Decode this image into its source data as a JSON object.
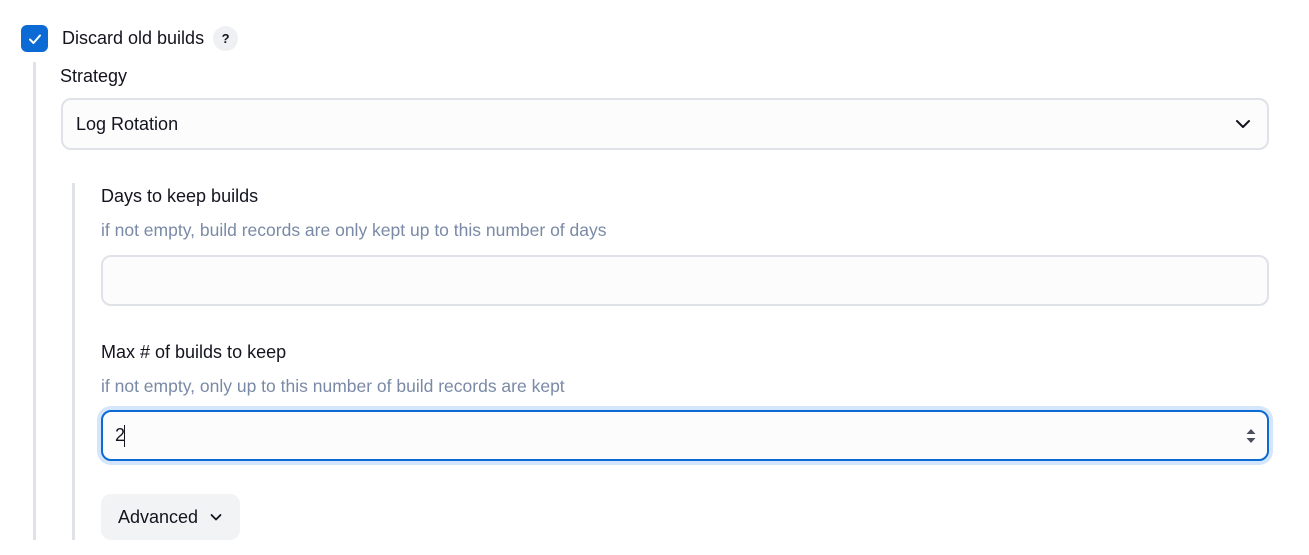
{
  "discard_old_builds": {
    "label": "Discard old builds",
    "checked": true,
    "help_label": "?"
  },
  "strategy": {
    "label": "Strategy",
    "selected": "Log Rotation"
  },
  "days_to_keep": {
    "label": "Days to keep builds",
    "description": "if not empty, build records are only kept up to this number of days",
    "value": ""
  },
  "max_builds": {
    "label": "Max # of builds to keep",
    "description": "if not empty, only up to this number of build records are kept",
    "value": "2"
  },
  "advanced": {
    "label": "Advanced"
  },
  "colors": {
    "accent": "#0b6ad3",
    "description_text": "#7a8aa6",
    "border": "#dfe2e8",
    "focus_ring": "#d4e6fb"
  },
  "icons": {
    "checkbox": "checkmark-icon",
    "help": "question-mark-icon",
    "select_chevron": "chevron-down-icon",
    "spinner": "up-down-arrows-icon",
    "advanced_chevron": "chevron-down-icon"
  }
}
